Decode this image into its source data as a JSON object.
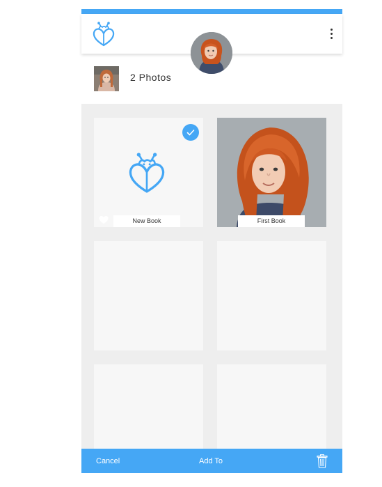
{
  "header": {
    "logo_icon": "ladybug-heart-logo-icon",
    "menu_icon": "overflow-menu-icon"
  },
  "summary": {
    "photo_count_text": "2 Photos"
  },
  "albums": [
    {
      "label": "New Book",
      "selected": true,
      "icon": "ladybug-heart-logo-icon"
    },
    {
      "label": "First Book",
      "selected": false,
      "icon": "child-photo"
    }
  ],
  "bottom_bar": {
    "cancel_label": "Cancel",
    "add_to_label": "Add To",
    "trash_icon": "trash-icon"
  },
  "colors": {
    "accent": "#45a7f5",
    "grid_background": "#eeeeee",
    "card_background": "#f7f7f7"
  }
}
